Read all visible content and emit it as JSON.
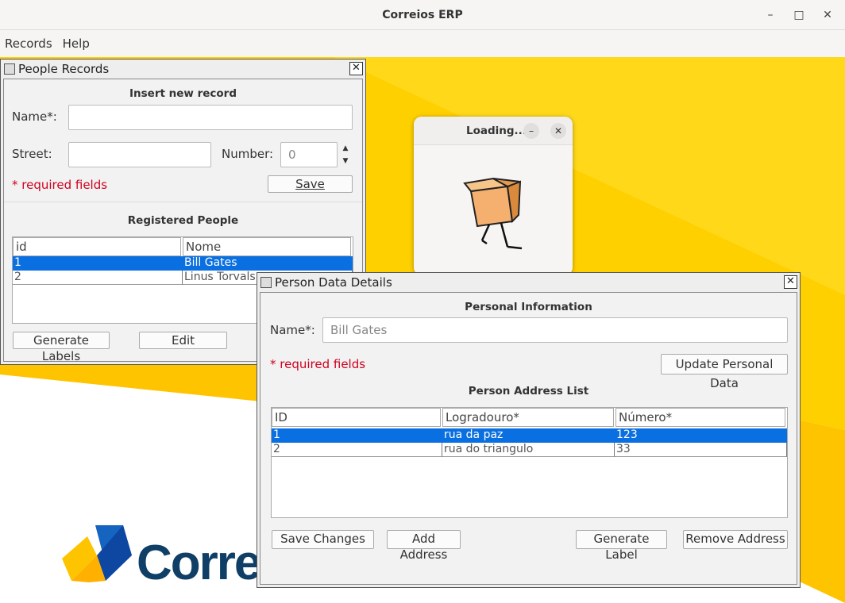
{
  "window": {
    "title": "Correios ERP",
    "minimize": "–",
    "maximize": "□",
    "close": "✕"
  },
  "menu": [
    {
      "label": "Records"
    },
    {
      "label": "Help"
    }
  ],
  "background": {
    "logo_text": "Corre"
  },
  "colors": {
    "accent_yellow": "#ffd000",
    "selection": "#0a6fe0",
    "required": "#d0001f"
  },
  "people_records": {
    "title": "People Records",
    "close": "✕",
    "insert_title": "Insert new record",
    "name_label": "Name*:",
    "name_value": "",
    "street_label": "Street:",
    "street_value": "",
    "number_label": "Number:",
    "number_value": "0",
    "required_note": "* required fields",
    "save_label": "Save",
    "registered_title": "Registered People",
    "table": {
      "columns": [
        "id",
        "Nome"
      ],
      "rows": [
        {
          "id": "1",
          "name": "Bill Gates",
          "selected": true
        },
        {
          "id": "2",
          "name": "Linus Torvals",
          "selected": false
        }
      ]
    },
    "generate_labels": "Generate Labels",
    "edit": "Edit"
  },
  "loading_dialog": {
    "title": "Loading...",
    "minimize": "–",
    "close": "✕",
    "icon": "walking-box-icon"
  },
  "person_details": {
    "title": "Person Data Details",
    "close": "✕",
    "section_personal": "Personal Information",
    "name_label": "Name*:",
    "name_value": "Bill Gates",
    "required_note": "* required fields",
    "update_button": "Update Personal Data",
    "section_address": "Person Address List",
    "table": {
      "columns": [
        "ID",
        "Logradouro*",
        "Número*"
      ],
      "rows": [
        {
          "id": "1",
          "street": "rua da paz",
          "number": "123",
          "selected": true
        },
        {
          "id": "2",
          "street": "rua do triangulo",
          "number": "33",
          "selected": false
        }
      ]
    },
    "save_changes": "Save Changes",
    "add_address": "Add Address",
    "generate_label": "Generate Label",
    "remove_address": "Remove Address"
  }
}
